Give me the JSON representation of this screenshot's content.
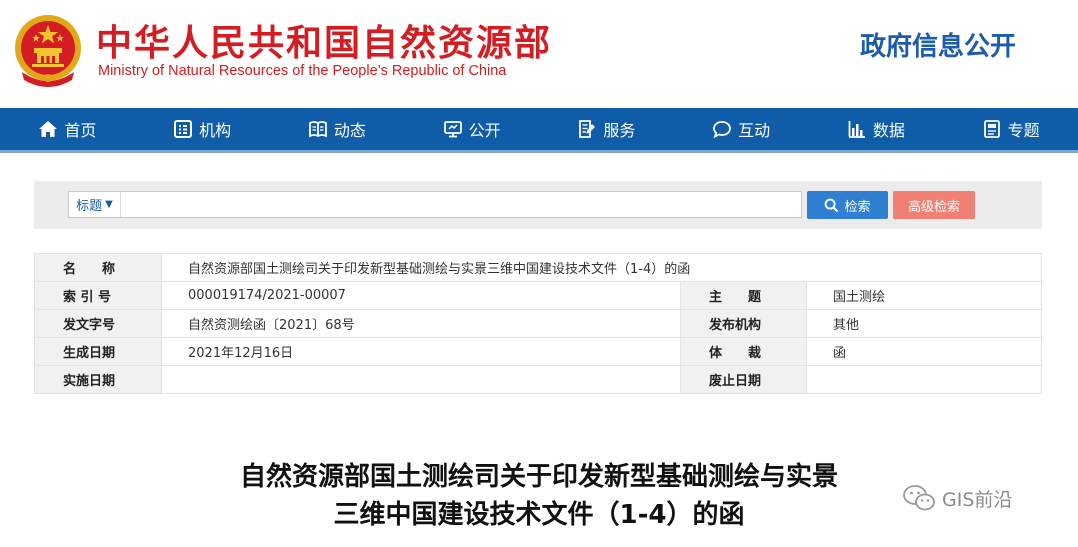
{
  "header": {
    "ministry_cn": "中华人民共和国自然资源部",
    "ministry_en": "Ministry of Natural Resources of the People’s Republic of China",
    "section": "政府信息公开"
  },
  "nav": {
    "items": [
      {
        "label": "首页",
        "icon": "home-icon"
      },
      {
        "label": "机构",
        "icon": "org-icon"
      },
      {
        "label": "动态",
        "icon": "book-icon"
      },
      {
        "label": "公开",
        "icon": "monitor-icon"
      },
      {
        "label": "服务",
        "icon": "document-edit-icon"
      },
      {
        "label": "互动",
        "icon": "chat-icon"
      },
      {
        "label": "数据",
        "icon": "bar-chart-icon"
      },
      {
        "label": "专题",
        "icon": "topic-icon"
      }
    ]
  },
  "search": {
    "select_label": "标题",
    "value": "",
    "search_button": "检索",
    "advanced_button": "高级检索"
  },
  "info": {
    "name_label": "名　　称",
    "name_value": "自然资源部国土测绘司关于印发新型基础测绘与实景三维中国建设技术文件（1-4）的函",
    "index_label": "索 引 号",
    "index_value": "000019174/2021-00007",
    "subject_label": "主　　题",
    "subject_value": "国土测绘",
    "doc_no_label": "发文字号",
    "doc_no_value": "自然资测绘函〔2021〕68号",
    "publisher_label": "发布机构",
    "publisher_value": "其他",
    "date_label": "生成日期",
    "date_value": "2021年12月16日",
    "genre_label": "体　　裁",
    "genre_value": "函",
    "effective_label": "实施日期",
    "effective_value": "",
    "expiry_label": "废止日期",
    "expiry_value": ""
  },
  "document": {
    "title_line1": "自然资源部国土测绘司关于印发新型基础测绘与实景",
    "title_line2": "三维中国建设技术文件（1-4）的函"
  },
  "watermark": {
    "text": "GIS前沿"
  },
  "colors": {
    "brand_red": "#d31d22",
    "nav_blue": "#0f5ca8",
    "search_blue": "#2f7fd2",
    "advanced_red": "#f07f74"
  }
}
